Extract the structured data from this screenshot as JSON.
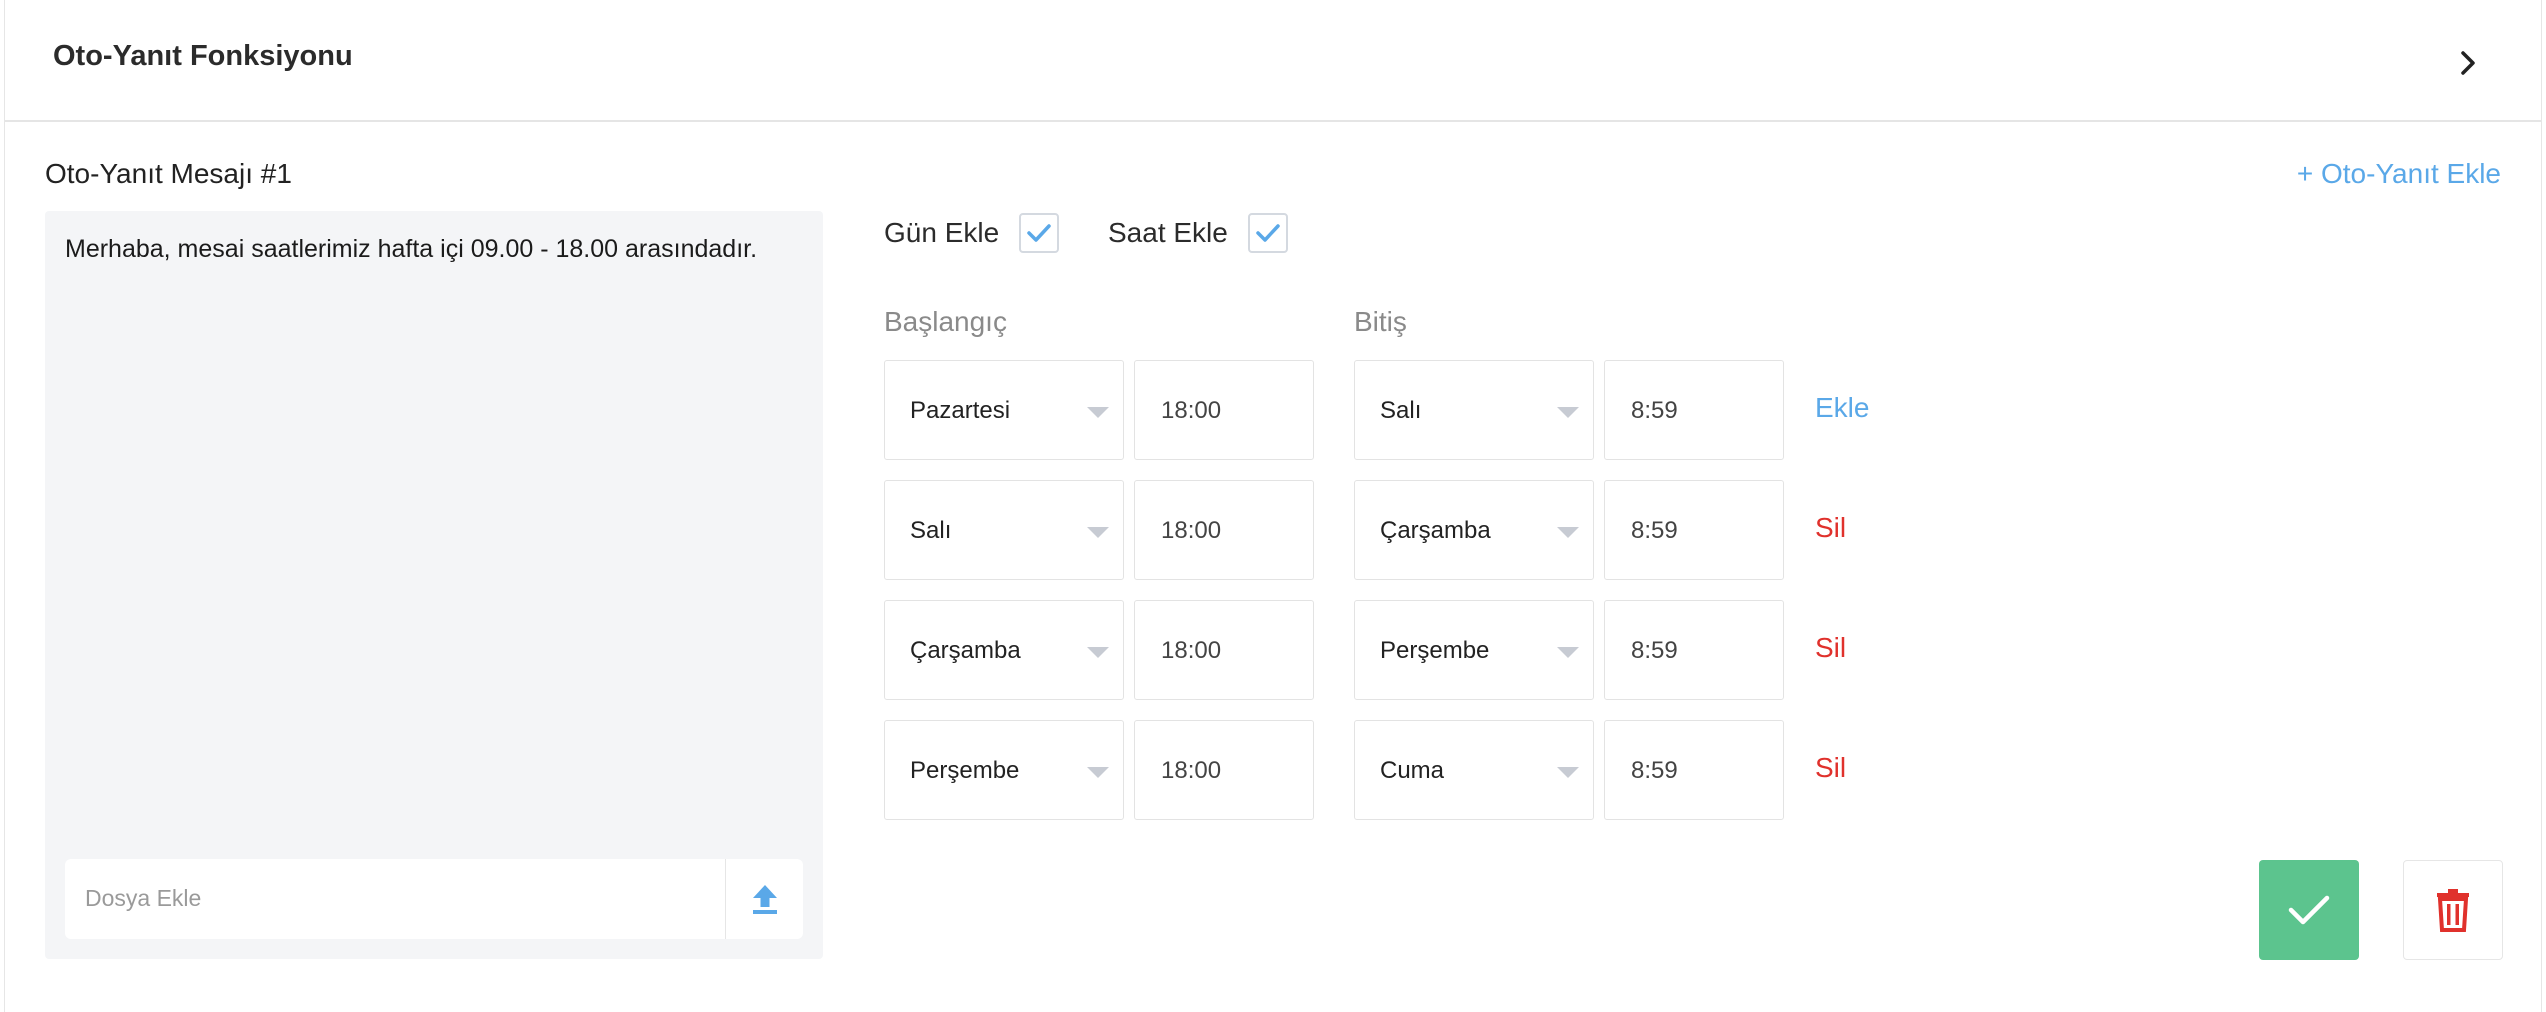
{
  "header": {
    "title": "Oto-Yanıt Fonksiyonu"
  },
  "message": {
    "title": "Oto-Yanıt Mesajı #1",
    "text": "Merhaba, mesai saatlerimiz hafta içi 09.00 - 18.00 arasındadır.",
    "file_placeholder": "Dosya Ekle"
  },
  "add_autoreply_label": "+ Oto-Yanıt Ekle",
  "options": {
    "add_day_label": "Gün Ekle",
    "add_day_checked": true,
    "add_time_label": "Saat Ekle",
    "add_time_checked": true
  },
  "columns": {
    "start": "Başlangıç",
    "end": "Bitiş"
  },
  "schedule": [
    {
      "start_day": "Pazartesi",
      "start_time": "18:00",
      "end_day": "Salı",
      "end_time": "8:59",
      "action": "Ekle",
      "action_type": "add"
    },
    {
      "start_day": "Salı",
      "start_time": "18:00",
      "end_day": "Çarşamba",
      "end_time": "8:59",
      "action": "Sil",
      "action_type": "delete"
    },
    {
      "start_day": "Çarşamba",
      "start_time": "18:00",
      "end_day": "Perşembe",
      "end_time": "8:59",
      "action": "Sil",
      "action_type": "delete"
    },
    {
      "start_day": "Perşembe",
      "start_time": "18:00",
      "end_day": "Cuma",
      "end_time": "8:59",
      "action": "Sil",
      "action_type": "delete"
    }
  ],
  "icons": {
    "chevron": "chevron-right-icon",
    "upload": "upload-icon",
    "check": "check-icon",
    "trash": "trash-icon"
  },
  "colors": {
    "accent_blue": "#5aa8e8",
    "delete_red": "#e0312c",
    "save_green": "#5cc48e"
  }
}
